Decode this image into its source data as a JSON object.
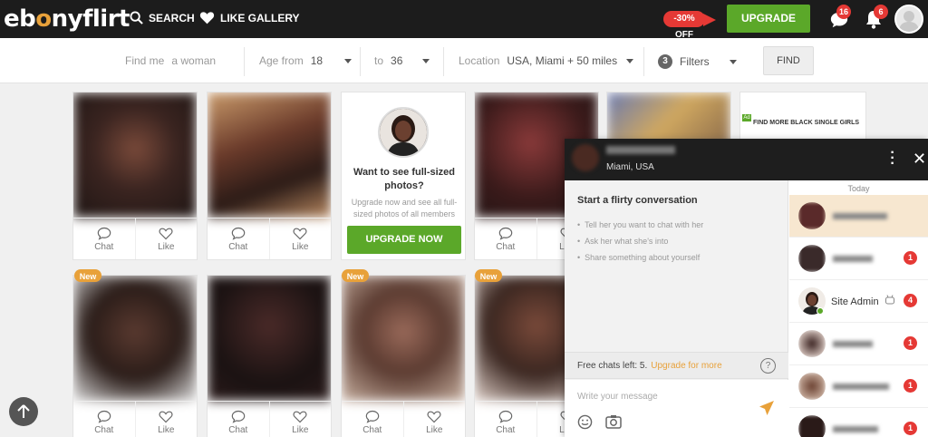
{
  "brand": {
    "logo_part1": "eb",
    "logo_part2": "nyflirt",
    "accent_color": "#e8a13a"
  },
  "nav": {
    "search_label": "SEARCH",
    "gallery_label": "LIKE GALLERY",
    "discount_label": "-30% OFF",
    "upgrade_label": "UPGRADE NOW",
    "messages_count": "16",
    "notifications_count": "6"
  },
  "filters": {
    "find_me_label": "Find me",
    "find_me_value": "a woman",
    "age_from_label": "Age from",
    "age_from_value": "18",
    "age_to_label": "to",
    "age_to_value": "36",
    "location_label": "Location",
    "location_value": "USA, Miami + 50 miles",
    "filters_count": "3",
    "filters_label": "Filters",
    "find_button": "FIND"
  },
  "card_actions": {
    "chat": "Chat",
    "like": "Like"
  },
  "new_tag": "New",
  "promo": {
    "title": "Want to see full-sized photos?",
    "subtitle": "Upgrade now and see all full-sized photos of all members",
    "button": "UPGRADE NOW"
  },
  "ad": {
    "tag": "Ad",
    "text": "FIND MORE BLACK SINGLE GIRLS"
  },
  "chat": {
    "location": "Miami, USA",
    "conversation_title": "Start a flirty conversation",
    "tips": [
      "Tell her you want to chat with her",
      "Ask her what she's into",
      "Share something about yourself"
    ],
    "free_chats_text": "Free chats left: 5.",
    "upgrade_link": "Upgrade for more",
    "help_symbol": "?",
    "message_placeholder": "Write your message",
    "today_label": "Today",
    "contacts": [
      {
        "name": "",
        "count": ""
      },
      {
        "name": "",
        "count": "1"
      },
      {
        "name": "Site Admin",
        "count": "4"
      },
      {
        "name": "",
        "count": "1"
      },
      {
        "name": "",
        "count": "1"
      },
      {
        "name": "",
        "count": "1"
      }
    ]
  },
  "icons": {
    "search": "search-icon",
    "heart": "heart-icon",
    "chat": "chat-bubble-icon",
    "bell": "bell-icon",
    "arrow_up": "arrow-up-icon",
    "emoji": "emoji-icon",
    "camera": "camera-icon",
    "send": "send-icon",
    "robot": "robot-icon"
  },
  "colors": {
    "green": "#5ba829",
    "red": "#e53935",
    "orange": "#e8a13a",
    "dark": "#1c1c1c"
  }
}
